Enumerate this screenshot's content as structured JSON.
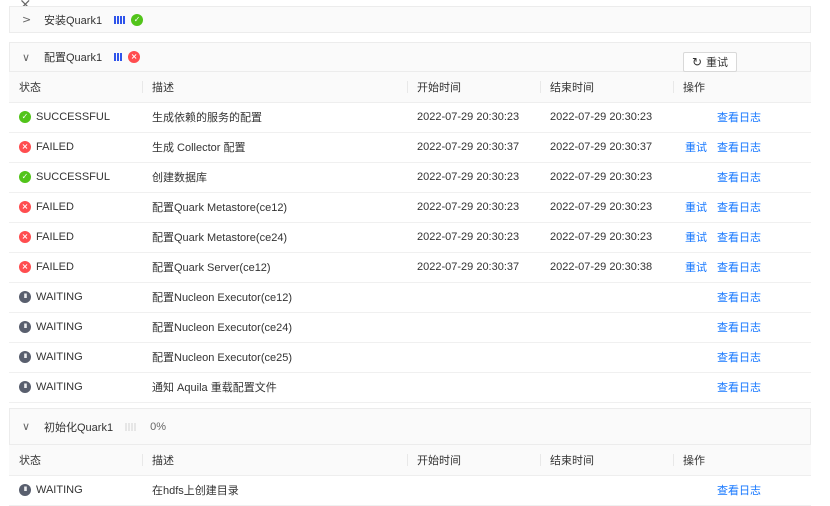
{
  "close_glyph": "×",
  "columns": {
    "status": "状态",
    "desc": "描述",
    "start": "开始时间",
    "end": "结束时间",
    "ops": "操作"
  },
  "sections": [
    {
      "title": "安装Quark1",
      "chevron": ">",
      "bars_count": 4,
      "state_icon": "success-icon",
      "collapsed": true
    },
    {
      "title": "配置Quark1",
      "chevron": "∨",
      "bars_count": 3,
      "state_icon": "error-icon",
      "retry_label": "重试",
      "retry_icon": "refresh-icon"
    },
    {
      "title": "初始化Quark1",
      "chevron": "∨",
      "percent": "0%"
    }
  ],
  "config_rows": [
    {
      "status": "SUCCESSFUL",
      "kind": "ok",
      "desc": "生成依赖的服务的配置",
      "start": "2022-07-29 20:30:23",
      "end": "2022-07-29 20:30:23",
      "retry": "",
      "log": "查看日志"
    },
    {
      "status": "FAILED",
      "kind": "fail",
      "desc": "生成 Collector 配置",
      "start": "2022-07-29 20:30:37",
      "end": "2022-07-29 20:30:37",
      "retry": "重试",
      "log": "查看日志"
    },
    {
      "status": "SUCCESSFUL",
      "kind": "ok",
      "desc": "创建数据库",
      "start": "2022-07-29 20:30:23",
      "end": "2022-07-29 20:30:23",
      "retry": "",
      "log": "查看日志"
    },
    {
      "status": "FAILED",
      "kind": "fail",
      "desc": "配置Quark Metastore(ce12)",
      "start": "2022-07-29 20:30:23",
      "end": "2022-07-29 20:30:23",
      "retry": "重试",
      "log": "查看日志"
    },
    {
      "status": "FAILED",
      "kind": "fail",
      "desc": "配置Quark Metastore(ce24)",
      "start": "2022-07-29 20:30:23",
      "end": "2022-07-29 20:30:23",
      "retry": "重试",
      "log": "查看日志"
    },
    {
      "status": "FAILED",
      "kind": "fail",
      "desc": "配置Quark Server(ce12)",
      "start": "2022-07-29 20:30:37",
      "end": "2022-07-29 20:30:38",
      "retry": "重试",
      "log": "查看日志"
    },
    {
      "status": "WAITING",
      "kind": "wait",
      "desc": "配置Nucleon Executor(ce12)",
      "start": "",
      "end": "",
      "retry": "",
      "log": "查看日志"
    },
    {
      "status": "WAITING",
      "kind": "wait",
      "desc": "配置Nucleon Executor(ce24)",
      "start": "",
      "end": "",
      "retry": "",
      "log": "查看日志"
    },
    {
      "status": "WAITING",
      "kind": "wait",
      "desc": "配置Nucleon Executor(ce25)",
      "start": "",
      "end": "",
      "retry": "",
      "log": "查看日志"
    },
    {
      "status": "WAITING",
      "kind": "wait",
      "desc": "通知 Aquila 重载配置文件",
      "start": "",
      "end": "",
      "retry": "",
      "log": "查看日志"
    }
  ],
  "init_rows": [
    {
      "status": "WAITING",
      "kind": "wait",
      "desc": "在hdfs上创建目录",
      "start": "",
      "end": "",
      "retry": "",
      "log": "查看日志"
    }
  ],
  "colors": {
    "link": "#1677ff",
    "success": "#52c41a",
    "error": "#ff4d4f",
    "waiting": "#595f6e",
    "progress": "#2f54eb"
  }
}
